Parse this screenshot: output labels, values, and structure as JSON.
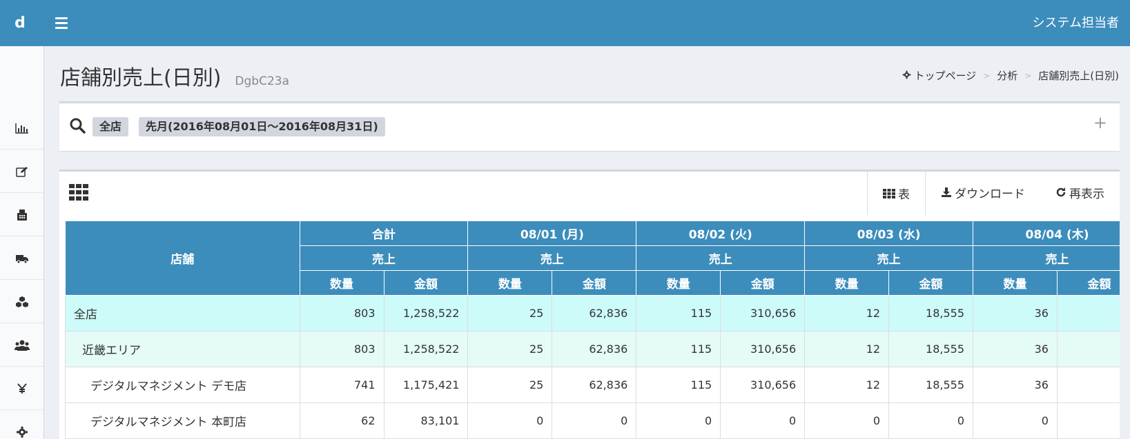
{
  "app": {
    "logo": "d",
    "user": "システム担当者"
  },
  "page": {
    "title": "店舗別売上(日別)",
    "code": "DgbC23a"
  },
  "breadcrumb": [
    "トップページ",
    "分析",
    "店舗別売上(日別)"
  ],
  "filter": {
    "tags": [
      "全店",
      "先月(2016年08月01日～2016年08月31日)"
    ],
    "expand": "+"
  },
  "tabs": [
    {
      "label": "表",
      "icon": "grid-icon"
    },
    {
      "label": "ダウンロード",
      "icon": "download-icon"
    },
    {
      "label": "再表示",
      "icon": "refresh-icon"
    }
  ],
  "table": {
    "store_header": "店舗",
    "groups": [
      "合計",
      "08/01 (月)",
      "08/02 (火)",
      "08/03 (水)",
      "08/04 (木)"
    ],
    "sub_header": "売上",
    "qty_header": "数量",
    "amount_header": "金額",
    "rows": [
      {
        "level": 0,
        "name": "全店",
        "cells": [
          "803",
          "1,258,522",
          "25",
          "62,836",
          "115",
          "310,656",
          "12",
          "18,555",
          "36",
          ""
        ]
      },
      {
        "level": 1,
        "name": "近畿エリア",
        "cells": [
          "803",
          "1,258,522",
          "25",
          "62,836",
          "115",
          "310,656",
          "12",
          "18,555",
          "36",
          ""
        ]
      },
      {
        "level": 2,
        "name": "デジタルマネジメント デモ店",
        "cells": [
          "741",
          "1,175,421",
          "25",
          "62,836",
          "115",
          "310,656",
          "12",
          "18,555",
          "36",
          ""
        ]
      },
      {
        "level": 2,
        "name": "デジタルマネジメント 本町店",
        "cells": [
          "62",
          "83,101",
          "0",
          "0",
          "0",
          "0",
          "0",
          "0",
          "0",
          ""
        ]
      }
    ]
  },
  "sidebar": [
    "bar-chart-icon",
    "edit-icon",
    "cash-register-icon",
    "truck-icon",
    "cubes-icon",
    "users-icon",
    "yen-icon",
    "gear-icon"
  ]
}
